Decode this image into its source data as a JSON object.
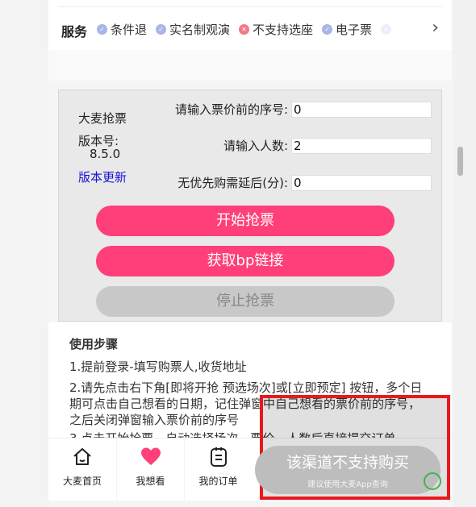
{
  "service": {
    "title": "服务",
    "items": [
      {
        "label": "条件退",
        "icon": "check-circle-icon",
        "color": "#a9b4e8"
      },
      {
        "label": "实名制观演",
        "icon": "check-circle-icon",
        "color": "#a9b4e8"
      },
      {
        "label": "不支持选座",
        "icon": "x-circle-icon",
        "color": "#f07a86"
      },
      {
        "label": "电子票",
        "icon": "check-circle-icon",
        "color": "#a9b4e8"
      },
      {
        "label": "",
        "icon": "check-circle-icon",
        "color": "#c9cff0"
      }
    ],
    "more_icon": "chevron-right-icon"
  },
  "panel": {
    "app_name": "大麦抢票",
    "version_label": "版本号:",
    "version_number": "8.5.0",
    "update_link": "版本更新",
    "fields": {
      "price_label": "请输入票价前的序号:",
      "price_value": "0",
      "count_label": "请输入人数:",
      "count_value": "2",
      "delay_label": "无优先购需延后(分):",
      "delay_value": "0"
    },
    "buttons": {
      "start": "开始抢票",
      "bp": "获取bp链接",
      "stop": "停止抢票"
    }
  },
  "steps": {
    "title": "使用步骤",
    "step1": "1.提前登录-填写购票人,收货地址",
    "step2": "2.请先点击右下角[即将开抢 预选场次]或[立即预定] 按钮，多个日期可点击自己想看的日期，记住弹窗中自己想看的票价前的序号，之后关闭弹窗输入票价前的序号",
    "step3": "3.点击开始抢票，自动选择场次，票价，人数后直接提交订单"
  },
  "tabbar": {
    "home": "大麦首页",
    "want": "我想看",
    "orders": "我的订单"
  },
  "buy": {
    "main": "该渠道不支持购买",
    "sub": "建议使用大麦App查询"
  },
  "colors": {
    "accent": "#ff3f79",
    "highlight": "#e8191e",
    "link": "#1414d6"
  }
}
